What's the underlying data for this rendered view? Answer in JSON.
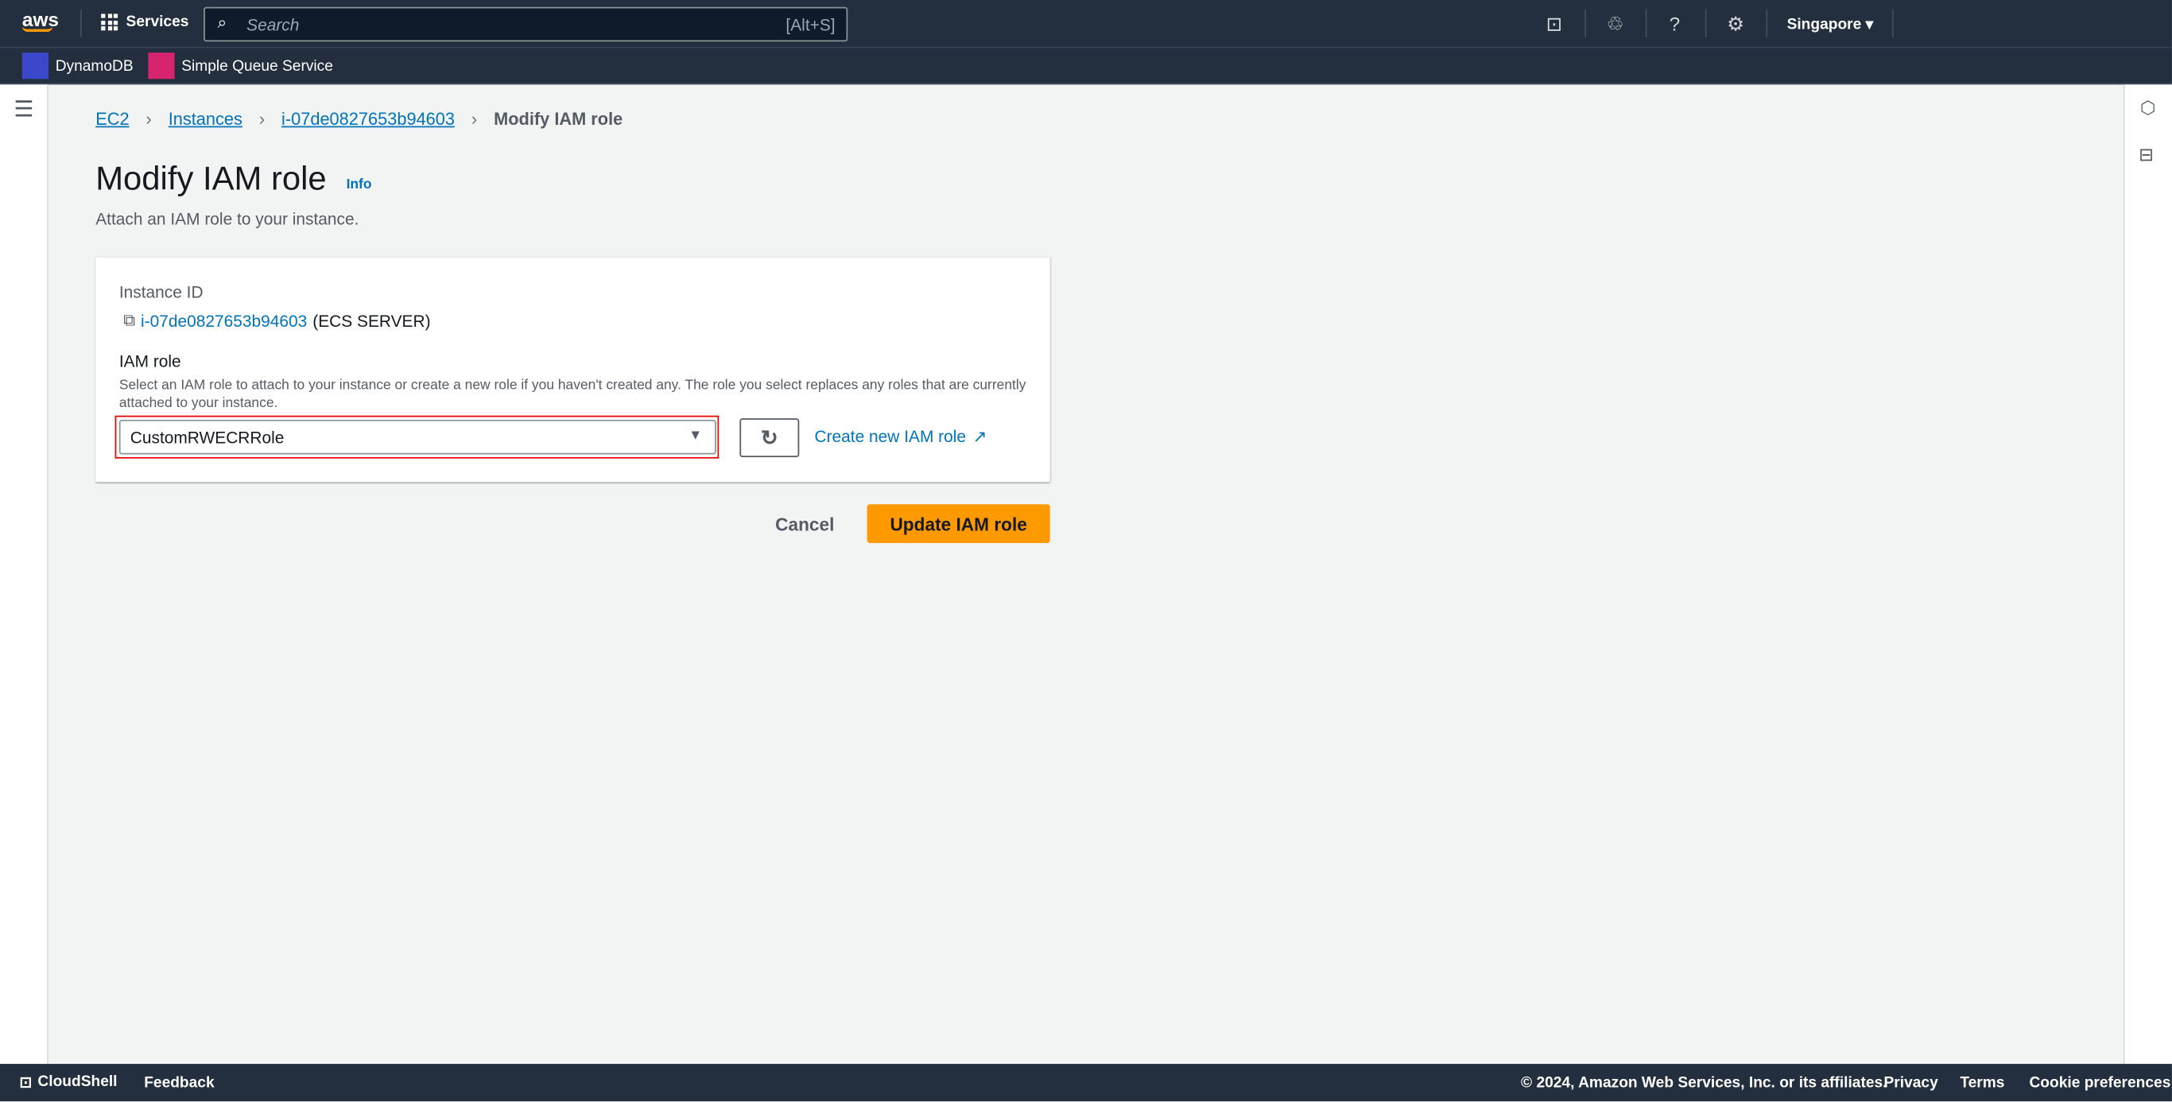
{
  "nav": {
    "logo": "aws",
    "services": "Services",
    "search_placeholder": "Search",
    "search_shortcut": "[Alt+S]",
    "region": "Singapore ▾"
  },
  "favorites": [
    {
      "label": "DynamoDB",
      "color": "#3b48cc"
    },
    {
      "label": "Simple Queue Service",
      "color": "#d6246e"
    }
  ],
  "breadcrumb": [
    "EC2",
    "Instances",
    "i-07de0827653b94603",
    "Modify IAM role"
  ],
  "page": {
    "title": "Modify IAM role",
    "info": "Info",
    "subtitle": "Attach an IAM role to your instance."
  },
  "form": {
    "instance_label": "Instance ID",
    "instance_id": "i-07de0827653b94603",
    "instance_name": "(ECS SERVER)",
    "role_label": "IAM role",
    "role_desc": "Select an IAM role to attach to your instance or create a new role if you haven't created any. The role you select replaces any roles that are currently attached to your instance.",
    "role_value": "CustomRWECRRole",
    "create_link": "Create new IAM role"
  },
  "actions": {
    "cancel": "Cancel",
    "submit": "Update IAM role",
    "accent": "#ff9900"
  },
  "footer": {
    "cloudshell": "CloudShell",
    "feedback": "Feedback",
    "copyright": "© 2024, Amazon Web Services, Inc. or its affiliates.",
    "privacy": "Privacy",
    "terms": "Terms",
    "cookies": "Cookie preferences"
  }
}
